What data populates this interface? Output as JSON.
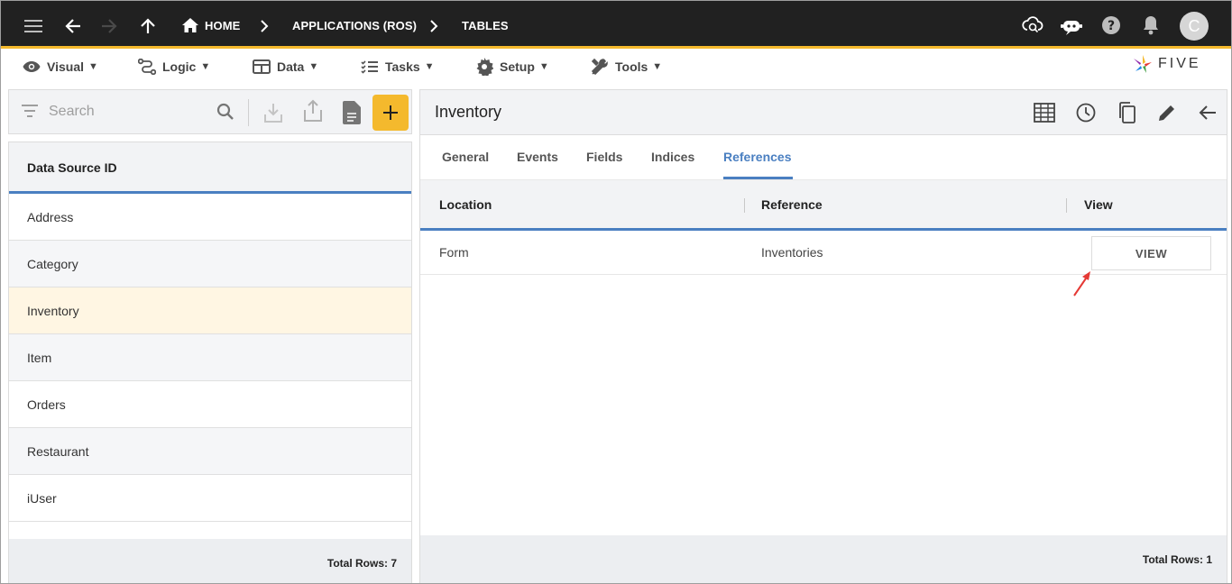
{
  "topbar": {
    "crumbs": [
      "HOME",
      "APPLICATIONS (ROS)",
      "TABLES"
    ],
    "avatar_letter": "C"
  },
  "menu": {
    "items": [
      {
        "label": "Visual",
        "icon": "eye-icon"
      },
      {
        "label": "Logic",
        "icon": "logic-icon"
      },
      {
        "label": "Data",
        "icon": "table-icon"
      },
      {
        "label": "Tasks",
        "icon": "tasks-icon"
      },
      {
        "label": "Setup",
        "icon": "gear-icon"
      },
      {
        "label": "Tools",
        "icon": "tools-icon"
      }
    ],
    "logo_text": "FIVE"
  },
  "left": {
    "search_placeholder": "Search",
    "column_header": "Data Source ID",
    "rows": [
      "Address",
      "Category",
      "Inventory",
      "Item",
      "Orders",
      "Restaurant",
      "iUser"
    ],
    "selected_row": "Inventory",
    "total_rows": "Total Rows: 7"
  },
  "right": {
    "title": "Inventory",
    "tabs": [
      "General",
      "Events",
      "Fields",
      "Indices",
      "References"
    ],
    "active_tab": "References",
    "columns": [
      "Location",
      "Reference",
      "View"
    ],
    "rows": [
      {
        "location": "Form",
        "reference": "Inventories",
        "view_label": "VIEW"
      }
    ],
    "total_rows": "Total Rows: 1"
  },
  "colors": {
    "topbar": "#212121",
    "accent": "#f4b92d",
    "primary_blue": "#4a7fc1",
    "selected_row": "#fff6e3",
    "annotation_arrow": "#e53935"
  }
}
